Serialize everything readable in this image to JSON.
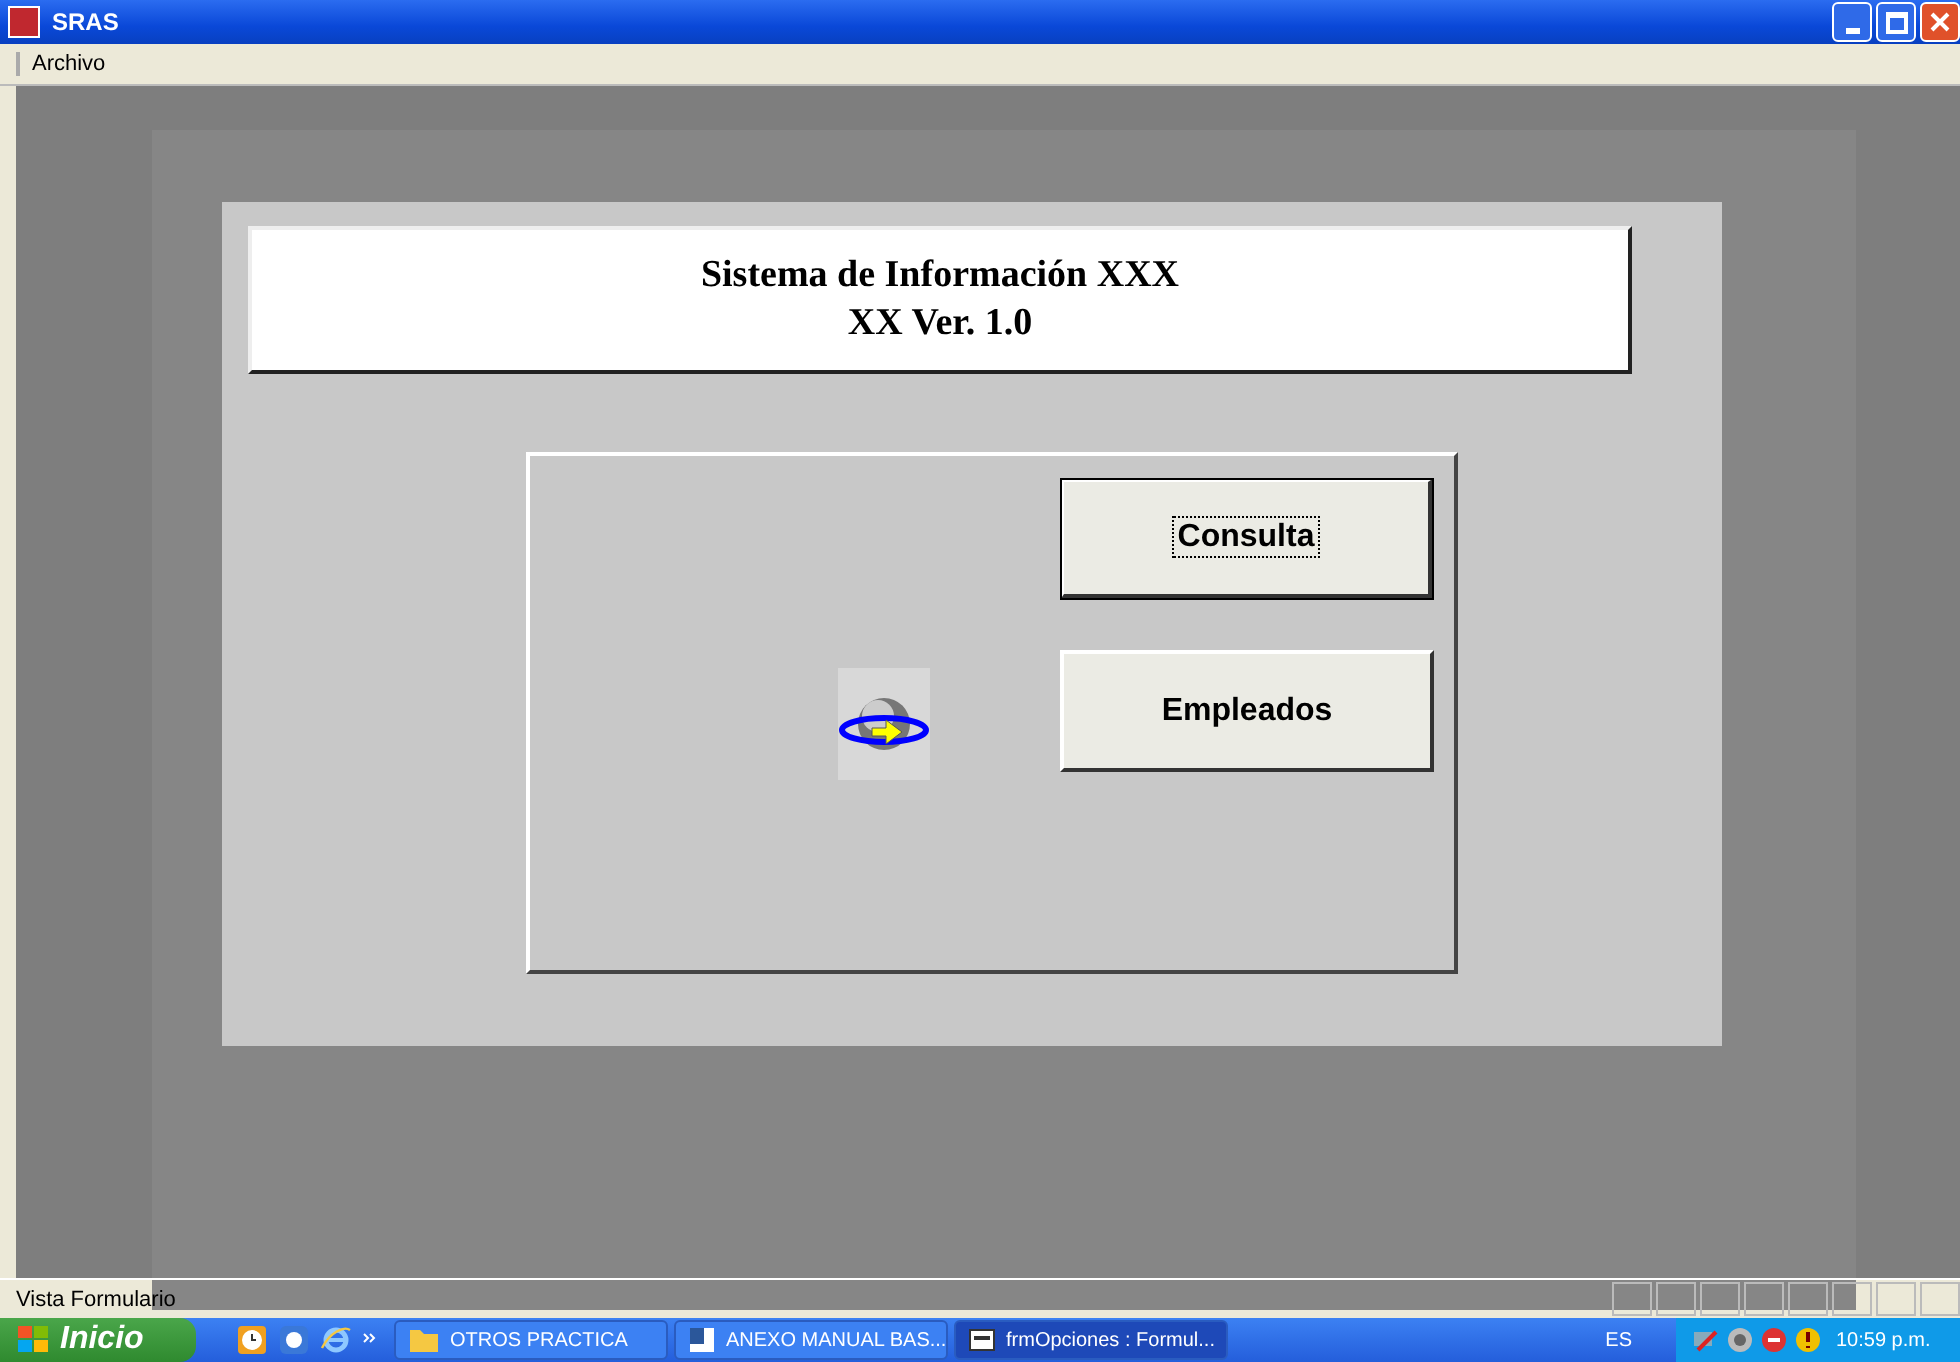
{
  "window": {
    "title": "SRAS"
  },
  "menu": [
    {
      "label": "Archivo"
    }
  ],
  "form": {
    "header": [
      "Sistema de Información XXX",
      "XX Ver. 1.0"
    ],
    "buttons": [
      {
        "label": "Consulta",
        "selected": true
      },
      {
        "label": "Empleados",
        "selected": false
      }
    ]
  },
  "status_bar": {
    "text": "Vista Formulario"
  },
  "taskbar": {
    "start": "Inicio",
    "tasks": [
      {
        "label": "OTROS PRACTICA",
        "kind": "folder",
        "selected": false
      },
      {
        "label": "ANEXO MANUAL BAS...",
        "kind": "document",
        "selected": false
      },
      {
        "label": "frmOpciones : Formul...",
        "kind": "form",
        "selected": true
      }
    ],
    "language": "ES",
    "clock": "10:59 p.m."
  }
}
